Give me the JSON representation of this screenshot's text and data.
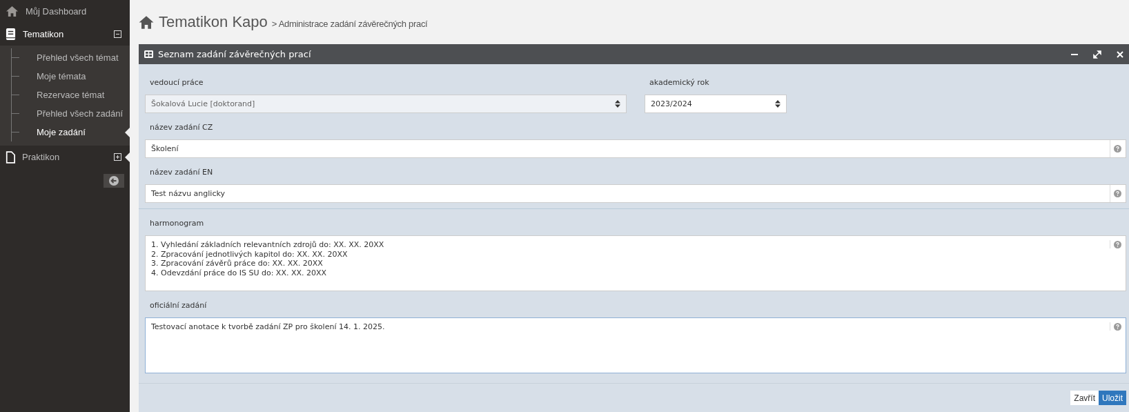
{
  "sidebar": {
    "items": [
      {
        "label": "Můj Dashboard",
        "selected": false
      },
      {
        "label": "Tematikon",
        "expanded": true,
        "selected": false,
        "children": [
          {
            "label": "Přehled všech témat",
            "selected": false
          },
          {
            "label": "Moje témata",
            "selected": false
          },
          {
            "label": "Rezervace témat",
            "selected": false
          },
          {
            "label": "Přehled všech zadání",
            "selected": false
          },
          {
            "label": "Moje zadání",
            "selected": true
          }
        ]
      },
      {
        "label": "Praktikon",
        "expanded": false,
        "selected": false
      }
    ]
  },
  "header": {
    "title": "Tematikon Kapo",
    "breadcrumb": "> Administrace zadání závěrečných prací"
  },
  "panel": {
    "title": "Seznam zadání závěrečných prací",
    "selects": [
      {
        "label": "vedoucí práce",
        "value": "Šokalová Lucie [doktorand]",
        "disabled": true
      },
      {
        "label": "akademický rok",
        "value": "2023/2024",
        "disabled": false
      }
    ],
    "fields": [
      {
        "kind": "input",
        "label": "název zadání CZ",
        "value": "Školení"
      },
      {
        "kind": "input",
        "label": "název zadání EN",
        "value": "Test názvu anglicky"
      },
      {
        "kind": "textarea",
        "label": "harmonogram",
        "value": "1. Vyhledání základních relevantních zdrojů do: XX. XX. 20XX\n2. Zpracování jednotlivých kapitol do: XX. XX. 20XX\n3. Zpracování závěrů práce do: XX. XX. 20XX\n4. Odevzdání práce do IS SU do: XX. XX. 20XX"
      },
      {
        "kind": "textarea",
        "label": "oficiální zadání",
        "value": "Testovací anotace k tvorbě zadání ZP pro školení 14. 1. 2025."
      }
    ],
    "buttons": [
      {
        "label": "Zavřít",
        "kind": "default"
      },
      {
        "label": "Uložit",
        "kind": "primary"
      }
    ]
  }
}
